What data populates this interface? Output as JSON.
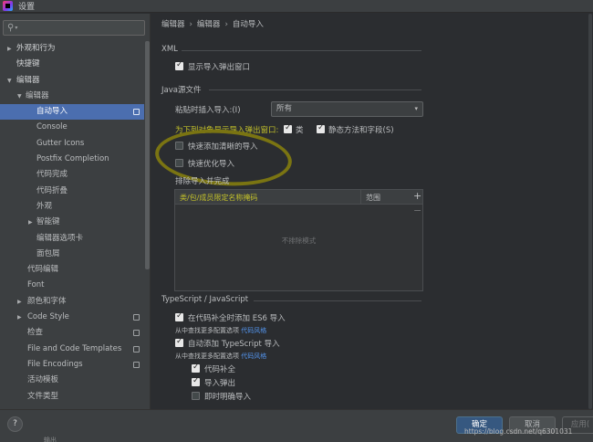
{
  "window": {
    "title": "设置"
  },
  "search": {
    "value": ""
  },
  "sidebar": {
    "items": [
      {
        "label": "外观和行为",
        "arrow": "right",
        "bold": true
      },
      {
        "label": "快捷键",
        "bold": true
      },
      {
        "label": "编辑器",
        "arrow": "down",
        "bold": true
      },
      {
        "label": "编辑器",
        "arrow": "down"
      },
      {
        "label": "自动导入",
        "selected": true,
        "icon": "copy-icon"
      },
      {
        "label": "Console"
      },
      {
        "label": "Gutter Icons"
      },
      {
        "label": "Postfix Completion"
      },
      {
        "label": "代码完成"
      },
      {
        "label": "代码折叠"
      },
      {
        "label": "外观"
      },
      {
        "label": "智能键",
        "arrow": "right"
      },
      {
        "label": "编辑器选项卡"
      },
      {
        "label": "面包屑"
      },
      {
        "label": "代码编辑"
      },
      {
        "label": "Font"
      },
      {
        "label": "颜色和字体",
        "arrow": "right"
      },
      {
        "label": "Code Style",
        "arrow": "right",
        "icon": "copy-icon"
      },
      {
        "label": "检查",
        "icon": "copy-icon"
      },
      {
        "label": "File and Code Templates",
        "icon": "copy-icon"
      },
      {
        "label": "File Encodings",
        "icon": "copy-icon"
      },
      {
        "label": "活动模板"
      },
      {
        "label": "文件类型"
      }
    ]
  },
  "breadcrumb": [
    "编辑器",
    "编辑器",
    "自动导入"
  ],
  "xml": {
    "title": "XML",
    "show_popup_label": "显示导入弹出窗口",
    "show_popup_checked": true
  },
  "java": {
    "title": "Java源文件",
    "paste_label": "粘贴时插入导入:(I)",
    "paste_value": "所有",
    "popup_for_label": "为下列对象显示导入弹出窗口:",
    "class_label": "类",
    "class_checked": true,
    "static_label": "静态方法和字段(S)",
    "static_checked": true,
    "add_unambiguous_label": "快速添加清晰的导入",
    "add_unambiguous_checked": false,
    "optimize_label": "快速优化导入",
    "optimize_checked": false,
    "exclude_label": "排除导入并完成",
    "table": {
      "col_pkg": "类/包/成员限定名称掩码",
      "col_scope": "范围",
      "empty": "不排除模式",
      "add": "+",
      "remove": "−"
    }
  },
  "typescript": {
    "title": "TypeScript / JavaScript",
    "es6_label": "在代码补全时添加 ES6 导入",
    "es6_checked": true,
    "hint1_text": "从中查找更多配置选项 ",
    "hint1_link": "代码风格",
    "ts_label": "自动添加 TypeScript 导入",
    "ts_checked": true,
    "hint2_text": "从中查找更多配置选项 ",
    "hint2_link": "代码风格",
    "code_completion_label": "代码补全",
    "code_completion_checked": true,
    "import_popup_label": "导入弹出",
    "import_popup_checked": true,
    "on_the_fly_label": "即时明确导入",
    "on_the_fly_checked": false
  },
  "bottom": {
    "help": "?",
    "ok": "确定",
    "cancel": "取消",
    "apply": "应用(",
    "cut_label": "输出",
    "watermark": "https://blog.csdn.net/q6301031"
  },
  "colors": {
    "accent": "#4b6eaf",
    "annotation": "#7a7412",
    "highlight_text": "#c2c02a",
    "link": "#5394ec"
  }
}
